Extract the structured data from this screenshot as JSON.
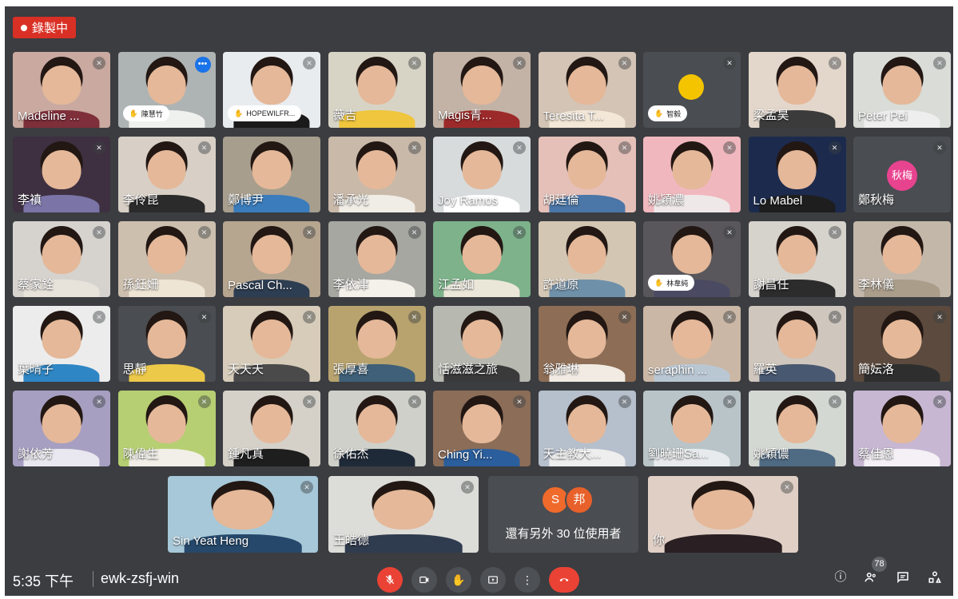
{
  "recording": {
    "label": "錄製中"
  },
  "tiles": [
    {
      "name": "Madeline ...",
      "bg": "#c9a9a0",
      "shirt": "#7e2f3a",
      "mic": true
    },
    {
      "name": "",
      "bg": "#aeb3b3",
      "shirt": "#eff1ef",
      "more": true,
      "hand": "陳慧竹"
    },
    {
      "name": "",
      "bg": "#e9ecee",
      "shirt": "#1a1a1a",
      "mic": true,
      "hand": "HOPEWILFR..."
    },
    {
      "name": "薇吉",
      "bg": "#d8d4c5",
      "shirt": "#efc63d",
      "mic": true
    },
    {
      "name": "Magis青...",
      "bg": "#c3b3a6",
      "shirt": "#9d2a2a",
      "mic": true
    },
    {
      "name": "Teresita T...",
      "bg": "#d3c4b5",
      "shirt": "#f3e7d7",
      "mic": true
    },
    {
      "name": "",
      "bg": "#4a4d51",
      "blank": true,
      "emoji": true,
      "mic": true,
      "hand": "智毅"
    },
    {
      "name": "梁孟昊",
      "bg": "#e3d7cc",
      "shirt": "#3b3b3b",
      "mic": true
    },
    {
      "name": "Peter Pei",
      "bg": "#d9dcd7",
      "shirt": "#eeeeee",
      "mic": true
    },
    {
      "name": "李禛",
      "bg": "#3e3040",
      "shirt": "#7a74a7",
      "mic": true
    },
    {
      "name": "李伶昆",
      "bg": "#d8d0c6",
      "shirt": "#2b2b2b",
      "mic": true
    },
    {
      "name": "鄭博尹",
      "bg": "#a79e8e",
      "shirt": "#3a7cbc",
      "mic": false
    },
    {
      "name": "潘承光",
      "bg": "#c9b9a9",
      "shirt": "#f0ede6",
      "mic": true
    },
    {
      "name": "Joy Ramos",
      "bg": "#d7dbdc",
      "shirt": "#ffffff",
      "mic": true
    },
    {
      "name": "胡廷倫",
      "bg": "#e5c0b8",
      "shirt": "#4a76a8",
      "mic": true
    },
    {
      "name": "姚穎濃",
      "bg": "#f0b8be",
      "shirt": "#efe8e8",
      "mic": true
    },
    {
      "name": "Lo Mabel",
      "bg": "#1c2a4d",
      "shirt": "#1e1e1e",
      "mic": true
    },
    {
      "name": "鄭秋梅",
      "bg": "#4a4d51",
      "blank": true,
      "initials": "秋梅",
      "mic": true
    },
    {
      "name": "蔡家銓",
      "bg": "#d6d3cf",
      "shirt": "#e7e2da",
      "mic": true
    },
    {
      "name": "孫鈺姍",
      "bg": "#cdbfae",
      "shirt": "#efe5d5",
      "mic": true
    },
    {
      "name": "Pascal Ch...",
      "bg": "#b6a58f",
      "shirt": "#2e3e52",
      "mic": true
    },
    {
      "name": "李依津",
      "bg": "#a6a7a1",
      "shirt": "#f4f0ea",
      "mic": true
    },
    {
      "name": "江孟如",
      "bg": "#7db28b",
      "shirt": "#ebe7d8",
      "mic": true
    },
    {
      "name": "許道原",
      "bg": "#d3c6b3",
      "shirt": "#6f90a9",
      "mic": false
    },
    {
      "name": "",
      "bg": "#59575c",
      "shirt": "#4a4a62",
      "mic": true,
      "hand": "林韋純"
    },
    {
      "name": "謝昌任",
      "bg": "#d6d2cc",
      "shirt": "#2c2c2c",
      "mic": true
    },
    {
      "name": "李林儀",
      "bg": "#c3b7a9",
      "shirt": "#aa9d8a",
      "mic": false
    },
    {
      "name": "葉晴子",
      "bg": "#ececec",
      "shirt": "#2f86c4",
      "mic": true
    },
    {
      "name": "思靜",
      "bg": "#4a4d51",
      "shirt": "#edc94a",
      "mic": true
    },
    {
      "name": "天天天",
      "bg": "#d7ccb9",
      "shirt": "#4a4a4a",
      "mic": true
    },
    {
      "name": "張厚喜",
      "bg": "#b8a36e",
      "shirt": "#3f6078",
      "mic": true
    },
    {
      "name": "恬滋滋之旅",
      "bg": "#b7b8b0",
      "shirt": "#3a3a3a",
      "mic": false
    },
    {
      "name": "翁雅琳",
      "bg": "#8d6d55",
      "shirt": "#f1ebe3",
      "mic": true
    },
    {
      "name": "seraphin ...",
      "bg": "#cbb7a5",
      "shirt": "#b9c7d3",
      "mic": true
    },
    {
      "name": "羅英",
      "bg": "#cfc6bd",
      "shirt": "#485870",
      "mic": true
    },
    {
      "name": "簡妘洛",
      "bg": "#5b4a3d",
      "shirt": "#2e2e2e",
      "mic": true
    },
    {
      "name": "謝依芳",
      "bg": "#a79fc1",
      "shirt": "#e9e7ef",
      "mic": true
    },
    {
      "name": "陳偉生",
      "bg": "#b6cf72",
      "shirt": "#f1efe7",
      "mic": true
    },
    {
      "name": "鍾凡真",
      "bg": "#d5d1c9",
      "shirt": "#1e1e1e",
      "mic": true
    },
    {
      "name": "徐佑杰",
      "bg": "#cfd0c9",
      "shirt": "#1f2a38",
      "mic": true
    },
    {
      "name": "Ching Yi...",
      "bg": "#8b6d58",
      "shirt": "#2b5e9c",
      "mic": true
    },
    {
      "name": "天主教大...",
      "bg": "#b6bfcc",
      "shirt": "#eeeeee",
      "mic": true
    },
    {
      "name": "劉曉珊Sa...",
      "bg": "#b9c4c9",
      "shirt": "#e7ebed",
      "mic": true
    },
    {
      "name": "姚穎儂",
      "bg": "#d4d8d2",
      "shirt": "#4f6a83",
      "mic": true
    },
    {
      "name": "蔡佳恩",
      "bg": "#c7b7d2",
      "shirt": "#f4f0f5",
      "mic": true
    }
  ],
  "bottom_tiles": [
    {
      "name": "Sin Yeat Heng",
      "bg": "#a6c8d8",
      "shirt": "#26486a",
      "mic": true
    },
    {
      "name": "王皓德",
      "bg": "#dcdcd8",
      "shirt": "#2f3b4e",
      "mic": true
    },
    {
      "name": "你",
      "bg": "#e0cfc5",
      "shirt": "#2a1f22",
      "mic": true
    }
  ],
  "others": {
    "avatars": [
      "S",
      "邦"
    ],
    "label": "還有另外 30 位使用者"
  },
  "toolbar": {
    "time": "5:35 下午",
    "meeting_code": "ewk-zsfj-win",
    "people_count": "78",
    "colors": {
      "accent_red": "#ea4335",
      "bg": "#3b3d41"
    }
  }
}
